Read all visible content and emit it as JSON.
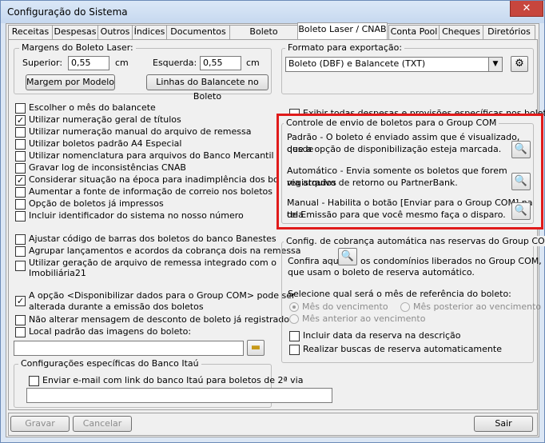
{
  "window": {
    "title": "Configuração do Sistema",
    "close": "✕"
  },
  "tabs": [
    "Receitas",
    "Despesas",
    "Outros",
    "Índices",
    "Documentos",
    "Boleto Matricial",
    "Boleto Laser / CNAB",
    "Conta Pool",
    "Cheques",
    "Diretórios"
  ],
  "margins": {
    "legend": "Margens do Boleto Laser:",
    "superior_label": "Superior:",
    "superior_value": "0,55",
    "superior_unit": "cm",
    "esquerda_label": "Esquerda:",
    "esquerda_value": "0,55",
    "esquerda_unit": "cm",
    "model_button": "Margem por Modelo",
    "balancete_button": "Linhas do Balancete no Boleto"
  },
  "export": {
    "legend": "Formato para exportação:",
    "selected": "Boleto (DBF) e Balancete (TXT)",
    "settings_icon": "settings-icon"
  },
  "options": [
    {
      "label": "Escolher o mês do balancete",
      "checked": false
    },
    {
      "label": "Utilizar numeração geral de títulos",
      "checked": true
    },
    {
      "label": "Utilizar numeração manual do arquivo de remessa",
      "checked": false
    },
    {
      "label": "Utilizar boletos padrão A4 Especial",
      "checked": false
    },
    {
      "label": "Utilizar nomenclatura para arquivos do Banco Mercantil",
      "checked": false
    },
    {
      "label": "Gravar log de inconsistências CNAB",
      "checked": false
    },
    {
      "label": "Considerar situação na época para inadimplência dos boletos",
      "checked": true
    },
    {
      "label": "Aumentar a fonte de informação de correio nos boletos",
      "checked": false
    },
    {
      "label": "Opção de boletos já impressos",
      "checked": false
    },
    {
      "label": "Incluir identificador do sistema no nosso número",
      "checked": false
    }
  ],
  "options2": [
    {
      "label": "Ajustar código de barras dos boletos do banco Banestes",
      "checked": false
    },
    {
      "label": "Agrupar lançamentos e acordos da cobrança dois na remessa",
      "checked": false
    },
    {
      "label": "Utilizar geração de arquivo de remessa integrado com o",
      "label2": "Imobiliária21",
      "checked": false
    }
  ],
  "options3": [
    {
      "label": "A opção <Disponibilizar dados para o Group COM> pode ser",
      "label2": "alterada durante a emissão dos boletos",
      "checked": true
    },
    {
      "label": "Não alterar mensagem de desconto de boleto já registrado",
      "checked": false
    },
    {
      "label": "Local padrão das imagens do boleto:",
      "checked": false
    }
  ],
  "exibir": {
    "label": "Exibir todas despesas e provisões específicas nos boletos",
    "checked": false
  },
  "groupcom": {
    "legend": "Controle de envio de boletos para o Group COM",
    "padrao": [
      "Padrão - O boleto é enviado assim que é visualizado, desde",
      "que a opção de disponibilização esteja marcada."
    ],
    "automatico": [
      "Automático - Envia somente os boletos que forem registrados",
      "via arquivo de retorno ou PartnerBank."
    ],
    "manual": [
      "Manual - Habilita o botão [Enviar para o Group COM] na tela",
      "de Emissão para que você mesmo faça o disparo."
    ]
  },
  "auto": {
    "legend": "Config. de cobrança automática nas reservas do Group COM",
    "confira_pre": "Confira aqui",
    "confira_post": "os condomínios liberados no Group COM,",
    "confira_line2": "que usam o boleto de reserva automático.",
    "month_label": "Selecione qual será o mês de referência do boleto:",
    "radio_vencimento": "Mês do vencimento",
    "radio_posterior": "Mês posterior ao vencimento",
    "radio_anterior": "Mês anterior ao vencimento",
    "incluir": "Incluir data da reserva na descrição",
    "realizar": "Realizar buscas de reserva automaticamente"
  },
  "itau": {
    "legend": "Configurações específicas do Banco Itaú",
    "email_label": "Enviar e-mail com link do banco Itaú para boletos de 2ª via"
  },
  "footer": {
    "gravar": "Gravar",
    "cancelar": "Cancelar",
    "sair": "Sair"
  },
  "icons": {
    "search": "search-icon",
    "folder": "folder-icon",
    "combo": "chevron-down-icon"
  }
}
